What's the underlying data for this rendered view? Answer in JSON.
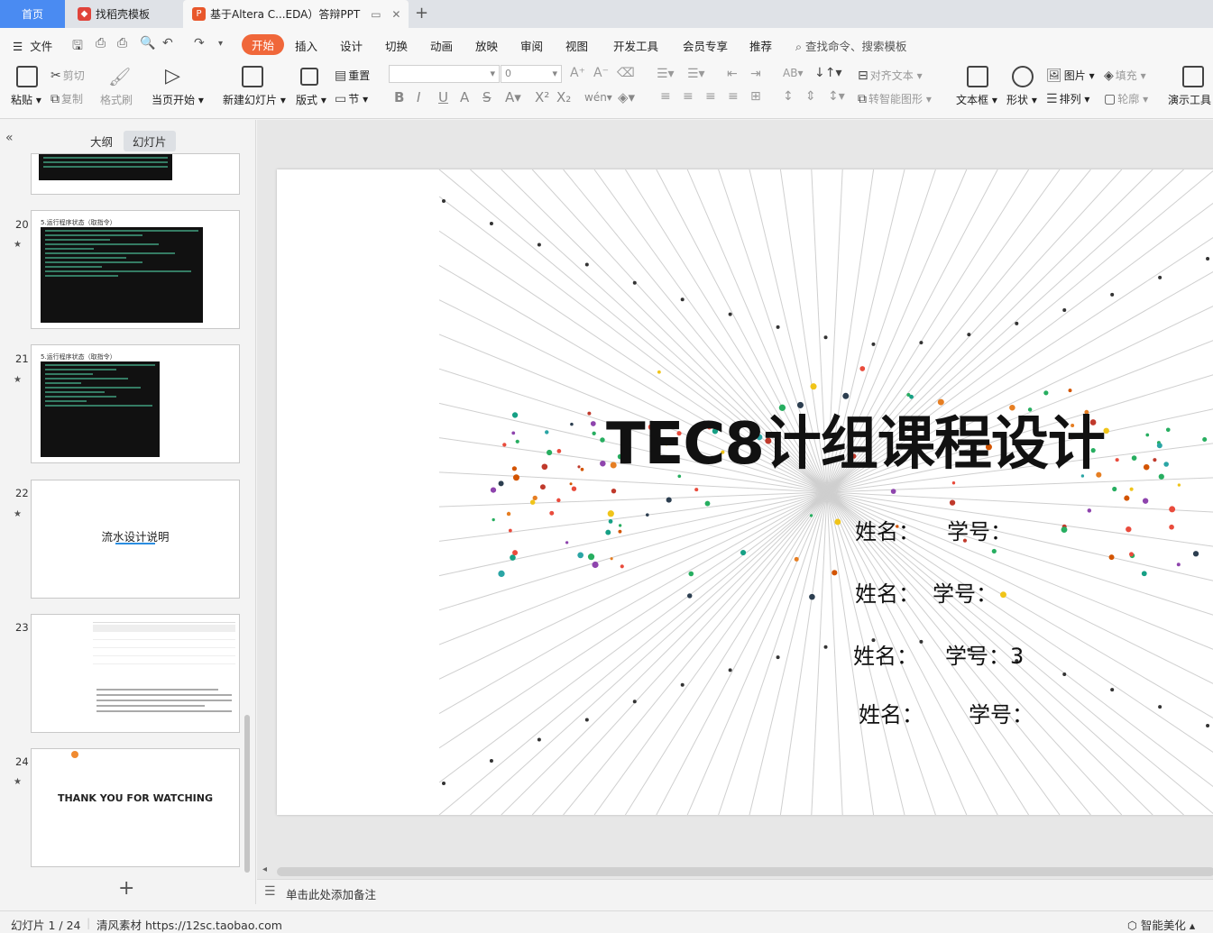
{
  "tabs": {
    "home": "首页",
    "template": "找稻壳模板",
    "doc": "基于Altera C...EDA）答辩PPT",
    "add": "+"
  },
  "menu": {
    "file": "文件",
    "items": [
      "开始",
      "插入",
      "设计",
      "切换",
      "动画",
      "放映",
      "审阅",
      "视图",
      "开发工具",
      "会员专享",
      "推荐"
    ],
    "search": "查找命令、搜索模板"
  },
  "ribbon": {
    "paste": "粘贴",
    "cut": "剪切",
    "copy": "复制",
    "format_painter": "格式刷",
    "play_from_current": "当页开始",
    "new_slide": "新建幻灯片",
    "layout": "版式",
    "reset": "重置",
    "section": "节",
    "font_name": "",
    "font_size": "0",
    "align_text": "对齐文本",
    "smart_art": "转智能图形",
    "textbox": "文本框",
    "shape": "形状",
    "picture": "图片",
    "arrange": "排列",
    "fill": "填充",
    "outline": "轮廓",
    "presentation_tools": "演示工具"
  },
  "panel": {
    "outline_tab": "大纲",
    "slides_tab": "幻灯片",
    "thumbs": [
      {
        "num": "20",
        "title": "5.运行程序状态（取指令）"
      },
      {
        "num": "21",
        "title": "5.运行程序状态（取指令）"
      },
      {
        "num": "22",
        "title": "流水设计说明"
      },
      {
        "num": "23",
        "title": ""
      },
      {
        "num": "24",
        "title": "THANK YOU FOR WATCHING"
      }
    ]
  },
  "slide": {
    "title": "TEC8计组课程设计",
    "lines": [
      {
        "name": "姓名：",
        "id": "学号："
      },
      {
        "name": "姓名：",
        "id": "学号："
      },
      {
        "name": "姓名：",
        "id": "学号：3"
      },
      {
        "name": "姓名：",
        "id": "学号："
      }
    ]
  },
  "notes_placeholder": "单击此处添加备注",
  "status": {
    "slide_pos": "幻灯片 1 / 24",
    "source": "清风素材 https://12sc.taobao.com",
    "beautify": "智能美化"
  },
  "colors": {
    "accent": "#f0673a",
    "home_tab": "#4a8bf2"
  }
}
